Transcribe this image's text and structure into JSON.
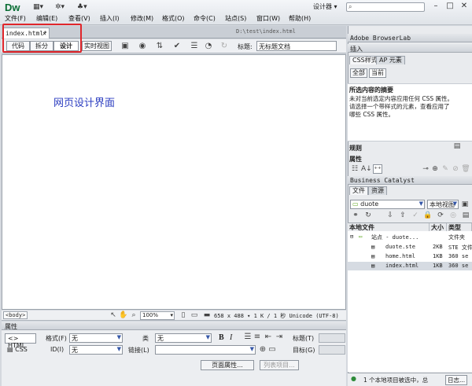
{
  "app": {
    "logo": "Dw",
    "workspace": "设计器",
    "search_placeholder": ""
  },
  "toolbar_icons": [
    "layout-icon",
    "gear-icon",
    "user-icon"
  ],
  "menu": [
    "文件(F)",
    "编辑(E)",
    "查看(V)",
    "插入(I)",
    "修改(M)",
    "格式(O)",
    "命令(C)",
    "站点(S)",
    "窗口(W)",
    "帮助(H)"
  ],
  "window_controls": [
    "–",
    "□",
    "✕"
  ],
  "document": {
    "tab": "index.html*",
    "tab_close": "✕",
    "path": "D:\\test\\index.html",
    "views": [
      "代码",
      "拆分",
      "设计"
    ],
    "live_view": "实时视图",
    "title_label": "标题:",
    "title_value": "无标题文档",
    "design_text": "网页设计界面"
  },
  "status": {
    "tag": "<body>",
    "zoom": "100%",
    "info": "658 x 488 ▾  1 K / 1 秒  Unicode (UTF-8)"
  },
  "properties": {
    "header": "属性",
    "html_btn": "HTML",
    "css_btn": "CSS",
    "format_label": "格式(F)",
    "format_value": "无",
    "id_label": "ID(I)",
    "id_value": "无",
    "class_label": "类",
    "class_value": "无",
    "link_label": "链接(L)",
    "bold": "B",
    "italic": "I",
    "title_label": "标题(T)",
    "target_label": "目标(G)",
    "page_props": "页面属性...",
    "list_item": "列表项目..."
  },
  "panels": {
    "browserlab": "Adobe BrowserLab",
    "insert": "插入",
    "css_tabs": [
      "CSS样式",
      "AP 元素"
    ],
    "css_modes": [
      "全部",
      "当前"
    ],
    "css_summary_title": "所选内容的摘要",
    "css_summary_text": [
      "未对当前选定内容应用任何 CSS 属性。",
      "请选择一个带样式的元素，查看应用了",
      "哪些 CSS 属性。"
    ],
    "rules": "规则",
    "attributes": "属性",
    "catalyst": "Business Catalyst",
    "files_tabs": [
      "文件",
      "资源"
    ],
    "site": "duote",
    "view": "本地视图",
    "files_cols": [
      "本地文件",
      "大小",
      "类型"
    ],
    "files": [
      {
        "name": "站点 - duote...",
        "size": "",
        "type": "文件夹"
      },
      {
        "name": "duote.ste",
        "size": "2KB",
        "type": "STE 文件"
      },
      {
        "name": "home.html",
        "size": "1KB",
        "type": "360 se"
      },
      {
        "name": "index.html",
        "size": "1KB",
        "type": "360 se"
      }
    ],
    "files_status": "1 个本地项目被选中，总",
    "log": "日志..."
  }
}
